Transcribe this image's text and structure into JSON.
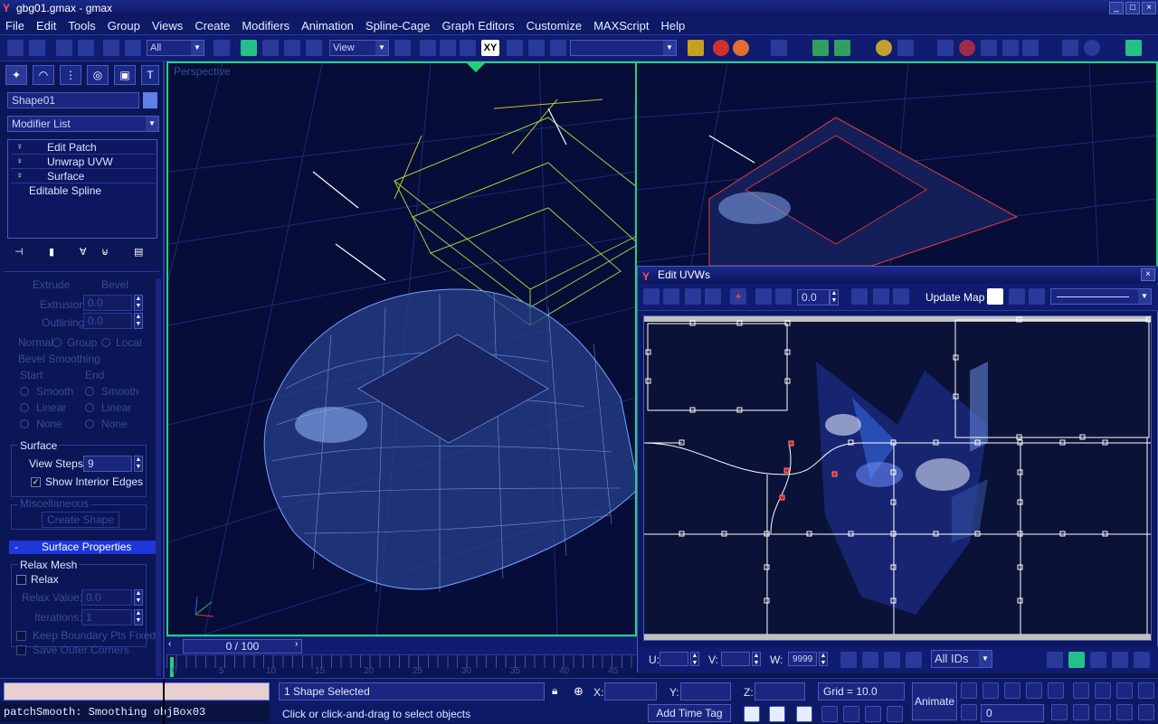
{
  "app": {
    "title": "gbg01.gmax - gmax",
    "window_buttons": [
      "_",
      "□",
      "×"
    ]
  },
  "menu": [
    "File",
    "Edit",
    "Tools",
    "Group",
    "Views",
    "Create",
    "Modifiers",
    "Animation",
    "Spline-Cage",
    "Graph Editors",
    "Customize",
    "MAXScript",
    "Help"
  ],
  "toolbar": {
    "selection_filter": "All",
    "reference_coord": "View",
    "axis_constraint": "XY",
    "named_selection": ""
  },
  "command_panel": {
    "object_name": "Shape01",
    "modifier_list": "Modifier List",
    "stack": [
      "Edit Patch",
      "Unwrap UVW",
      "Surface",
      "Editable Spline"
    ],
    "bevel": {
      "extrude_label": "Extrude",
      "bevel_label": "Bevel",
      "extrusion_label": "Extrusion:",
      "extrusion_value": "0.0",
      "outlining_label": "Outlining:",
      "outlining_value": "0.0",
      "normal_label": "Normal",
      "group_label": "Group",
      "local_label": "Local",
      "bevel_smoothing": "Bevel Smoothing",
      "start": "Start",
      "end": "End",
      "smooth": "Smooth",
      "linear": "Linear",
      "none": "None"
    },
    "surface": {
      "group_title": "Surface",
      "view_steps_label": "View Steps:",
      "view_steps_value": "9",
      "show_interior_edges": "Show Interior Edges"
    },
    "misc": {
      "group_title": "Miscellaneous",
      "create_shape": "Create Shape"
    },
    "surface_properties": {
      "rollout_sign": "-",
      "rollout_title": "Surface Properties",
      "relax_mesh": "Relax Mesh",
      "relax": "Relax",
      "relax_value_label": "Relax Value:",
      "relax_value": "0.0",
      "iterations_label": "Iterations:",
      "iterations_value": "1",
      "keep_boundary": "Keep Boundary Pts Fixed",
      "save_outer": "Save Outer Corners"
    }
  },
  "viewport": {
    "label": "Perspective"
  },
  "uvw": {
    "title": "Edit UVWs",
    "spinner_value": "0.0",
    "update_map": "Update Map",
    "u_label": "U:",
    "v_label": "V:",
    "w_label": "W:",
    "w_value": "9999",
    "ids": "All IDs"
  },
  "timeslider": {
    "frame": "0 / 100",
    "ticks": [
      "0",
      "5",
      "10",
      "15",
      "20",
      "25",
      "30",
      "35",
      "40",
      "45"
    ]
  },
  "status": {
    "maxscript_output": "patchSmooth: Smoothing objBox03",
    "selection": "1 Shape Selected",
    "prompt": "Click or click-and-drag to select objects",
    "x_label": "X:",
    "y_label": "Y:",
    "z_label": "Z:",
    "grid": "Grid = 10.0",
    "add_time_tag": "Add Time Tag",
    "animate": "Animate",
    "frame_value": "0"
  },
  "colors": {
    "ui_bg": "#0d1a66",
    "viewport_border": "#26d07a",
    "accent_red": "#ff5050",
    "highlight": "#1f36d8"
  }
}
